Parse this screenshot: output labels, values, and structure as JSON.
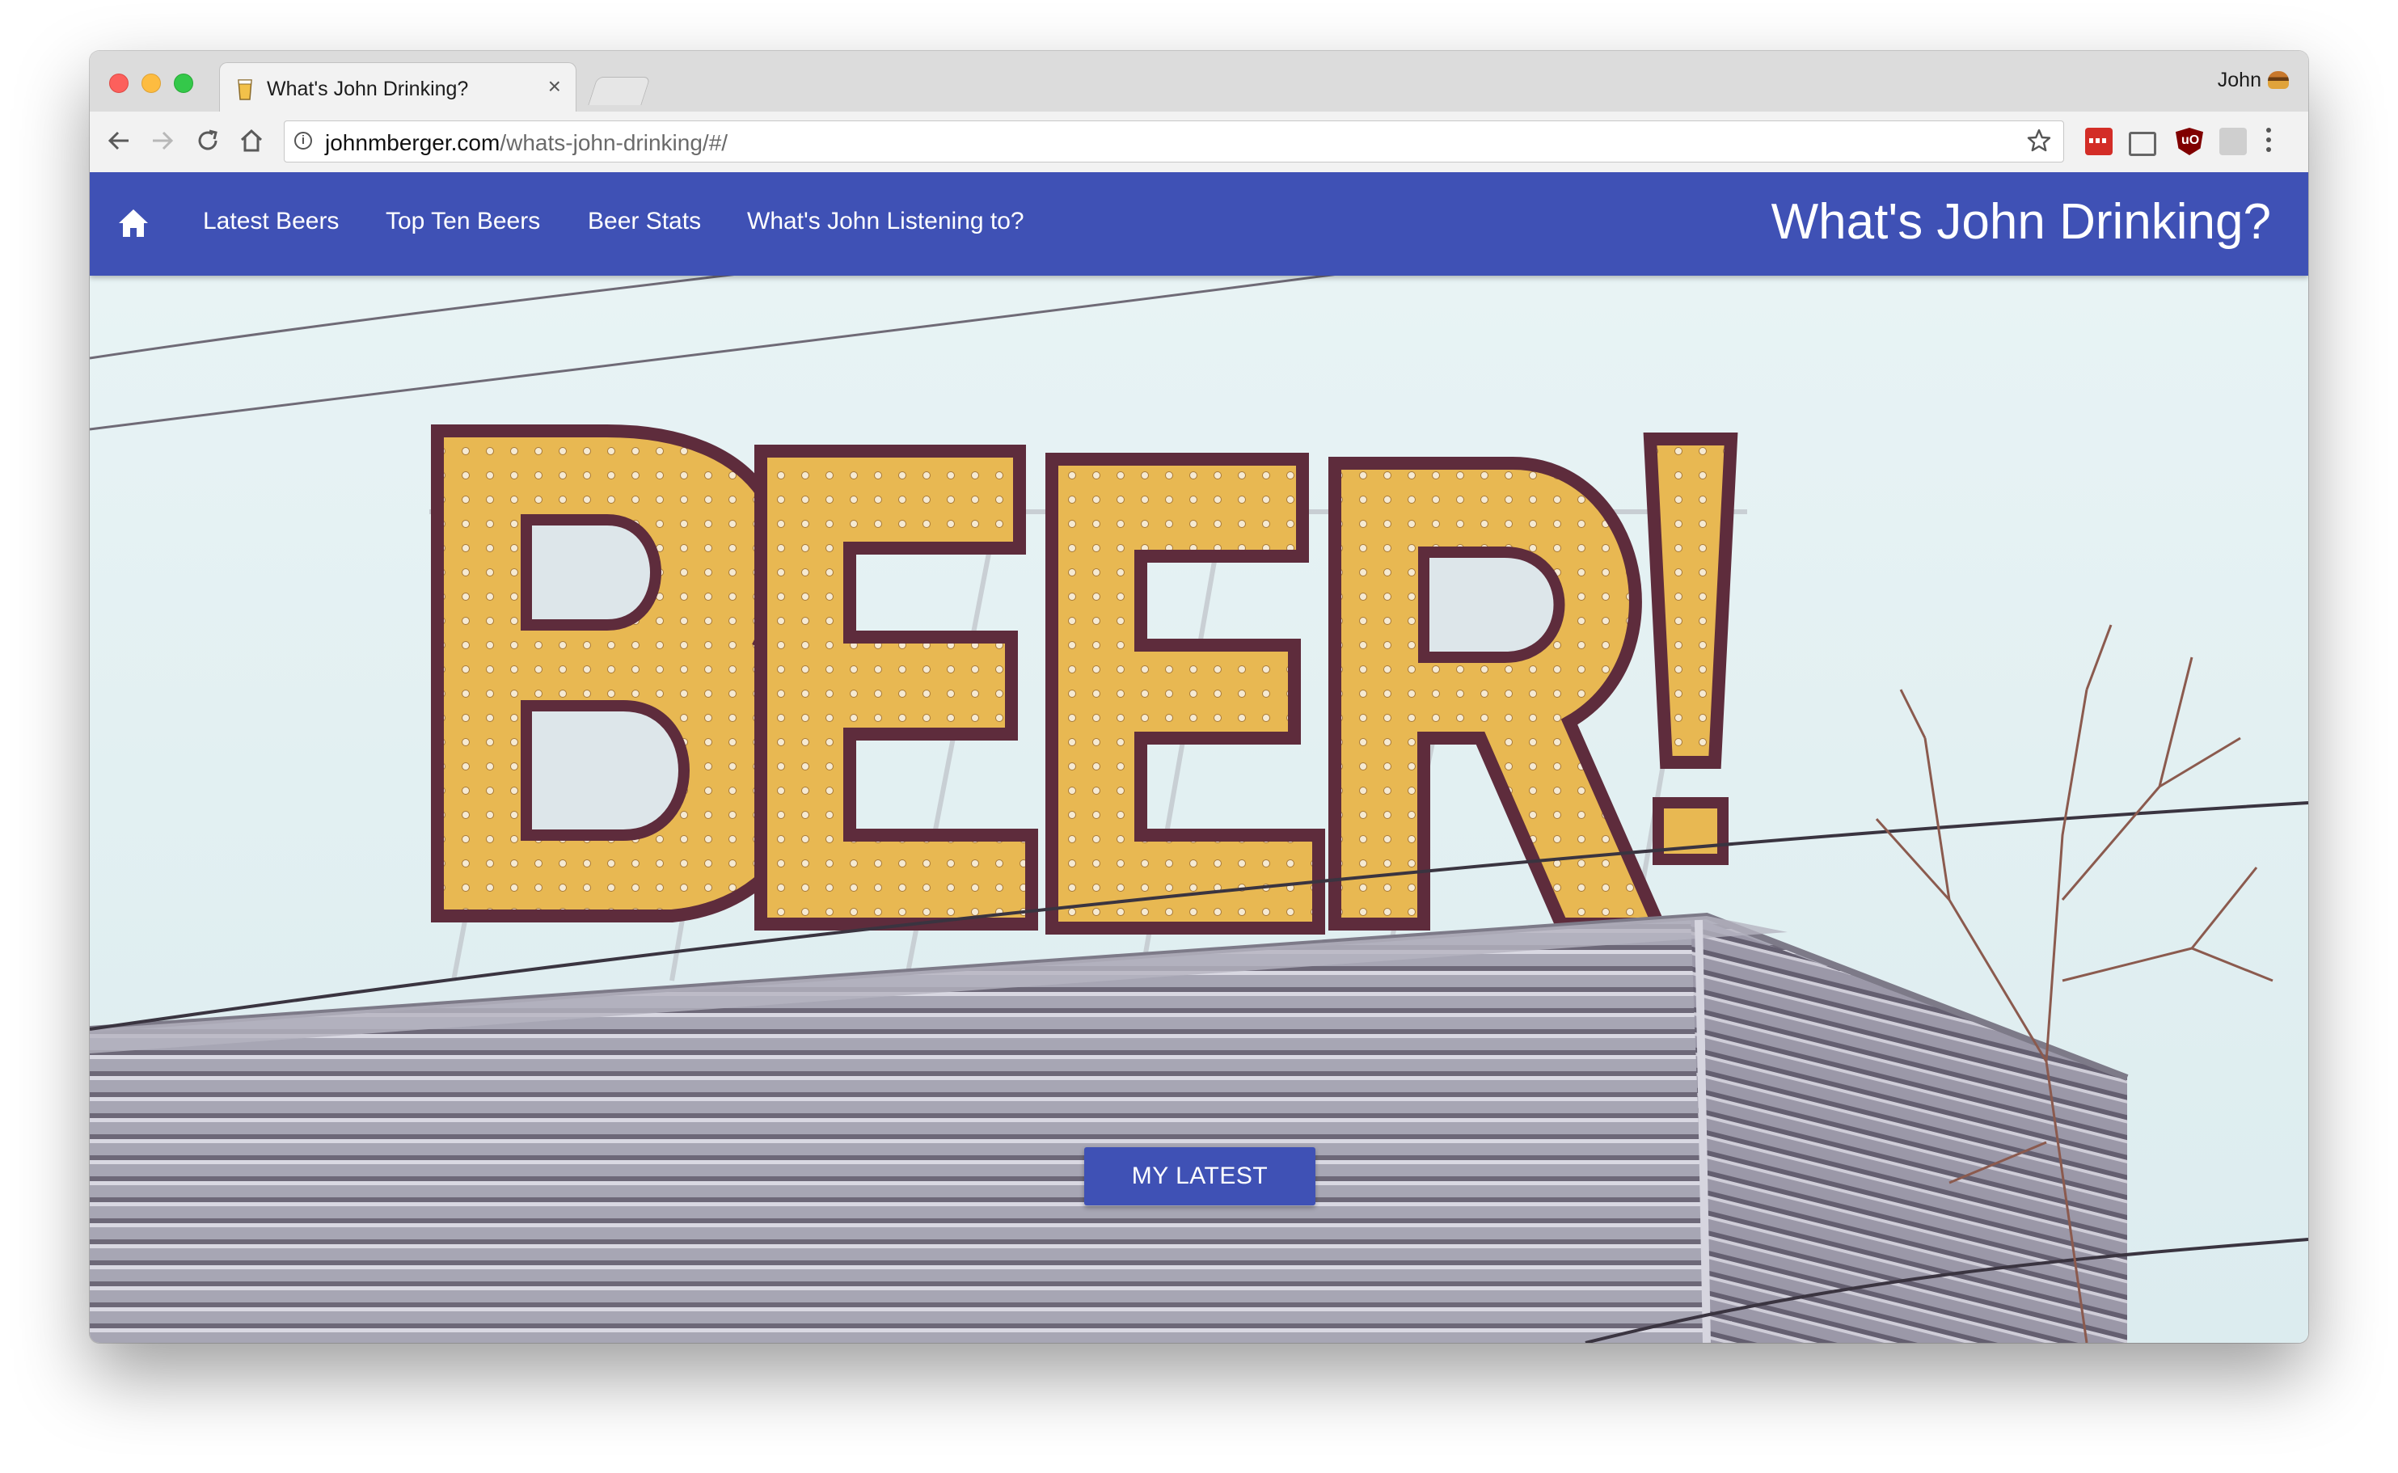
{
  "browser": {
    "tab_title": "What's John Drinking?",
    "tab_close": "×",
    "profile_name": "John",
    "url_host": "johnmberger.com",
    "url_path": "/whats-john-drinking/#/"
  },
  "site": {
    "title": "What's John Drinking?",
    "nav": {
      "latest": "Latest Beers",
      "top_ten": "Top Ten Beers",
      "stats": "Beer Stats",
      "listening": "What's John Listening to?"
    },
    "hero_sign": "BEER!",
    "cta_label": "MY LATEST"
  },
  "colors": {
    "app_bar": "#3f51b5",
    "sign_letter": "#e8b852",
    "sign_border": "#5e2c3c"
  },
  "icons": [
    "home-icon",
    "info-icon",
    "star-icon",
    "back-arrow-icon",
    "forward-arrow-icon",
    "reload-icon",
    "browser-home-icon"
  ]
}
